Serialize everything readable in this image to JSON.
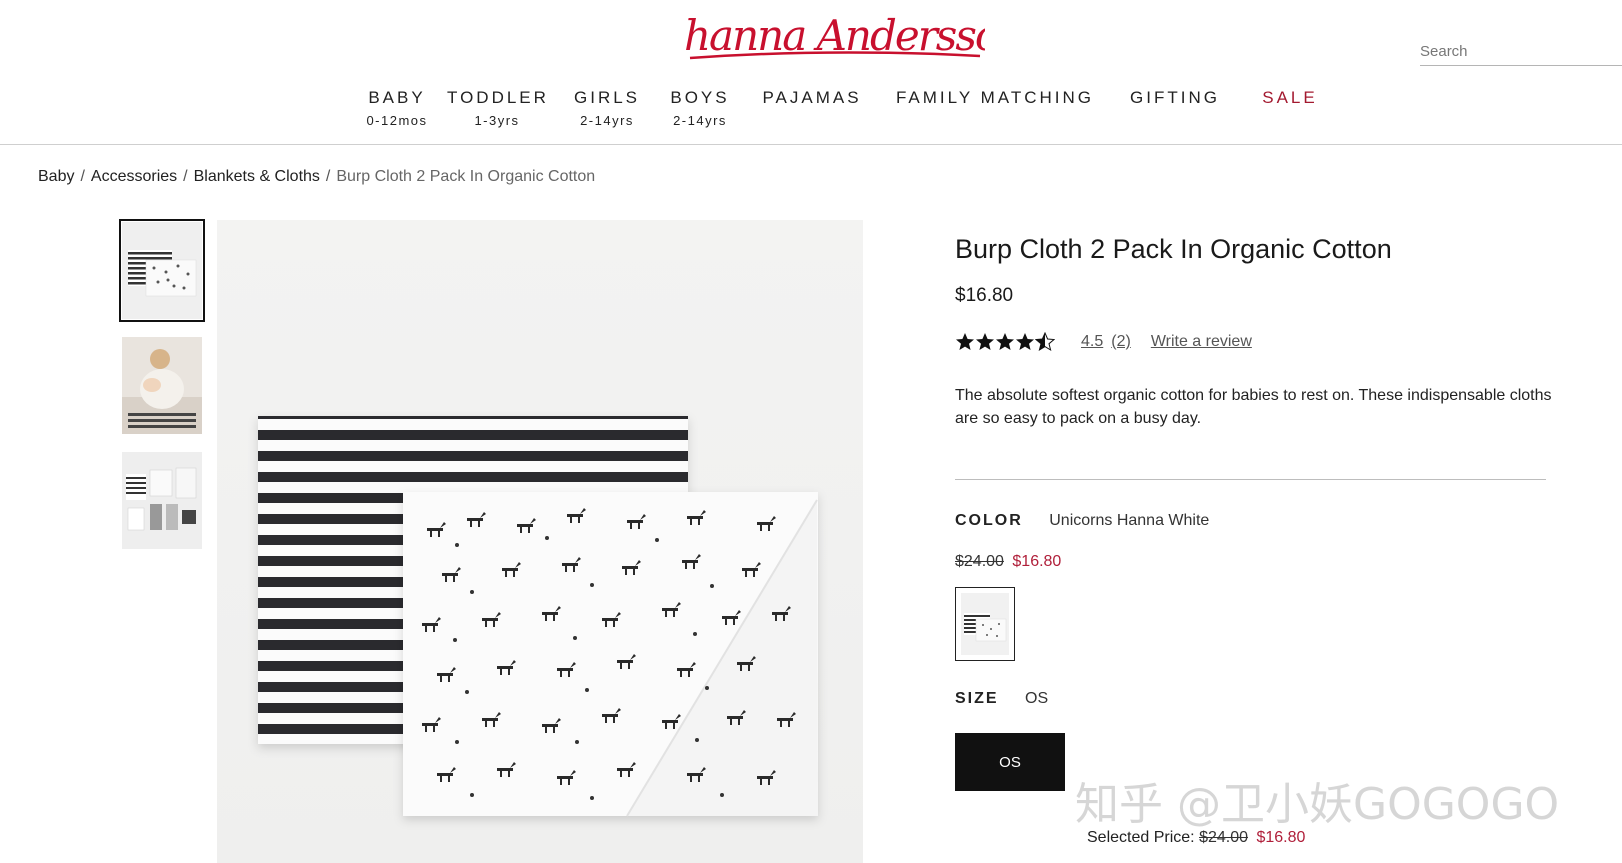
{
  "header": {
    "logo_text": "hanna Andersson",
    "search_placeholder": "Search",
    "nav": [
      {
        "label": "BABY",
        "sub": "0-12mos"
      },
      {
        "label": "TODDLER",
        "sub": "1-3yrs"
      },
      {
        "label": "GIRLS",
        "sub": "2-14yrs"
      },
      {
        "label": "BOYS",
        "sub": "2-14yrs"
      },
      {
        "label": "PAJAMAS",
        "sub": ""
      },
      {
        "label": "FAMILY MATCHING",
        "sub": ""
      },
      {
        "label": "GIFTING",
        "sub": ""
      },
      {
        "label": "SALE",
        "sub": ""
      }
    ]
  },
  "breadcrumb": {
    "items": [
      "Baby",
      "Accessories",
      "Blankets & Cloths"
    ],
    "current": "Burp Cloth 2 Pack In Organic Cotton",
    "separator": "/"
  },
  "product": {
    "title": "Burp Cloth 2 Pack In Organic Cotton",
    "price": "$16.80",
    "rating": "4.5",
    "rating_stars": 4.5,
    "review_count": "(2)",
    "write_review": "Write a review",
    "description": "The absolute softest organic cotton for babies to rest on. These indispensable cloths are so easy to pack on a busy day.",
    "color_label": "COLOR",
    "color_value": "Unicorns Hanna White",
    "original_price": "$24.00",
    "sale_price": "$16.80",
    "size_label": "SIZE",
    "size_value": "OS",
    "size_button": "OS",
    "selected_price_label": "Selected Price:",
    "selected_original": "$24.00",
    "selected_sale": "$16.80"
  },
  "watermark": "知乎 @卫小妖GOGOGO",
  "colors": {
    "brand_red": "#c8102e",
    "sale_red": "#b01f3a",
    "button_black": "#111111"
  }
}
